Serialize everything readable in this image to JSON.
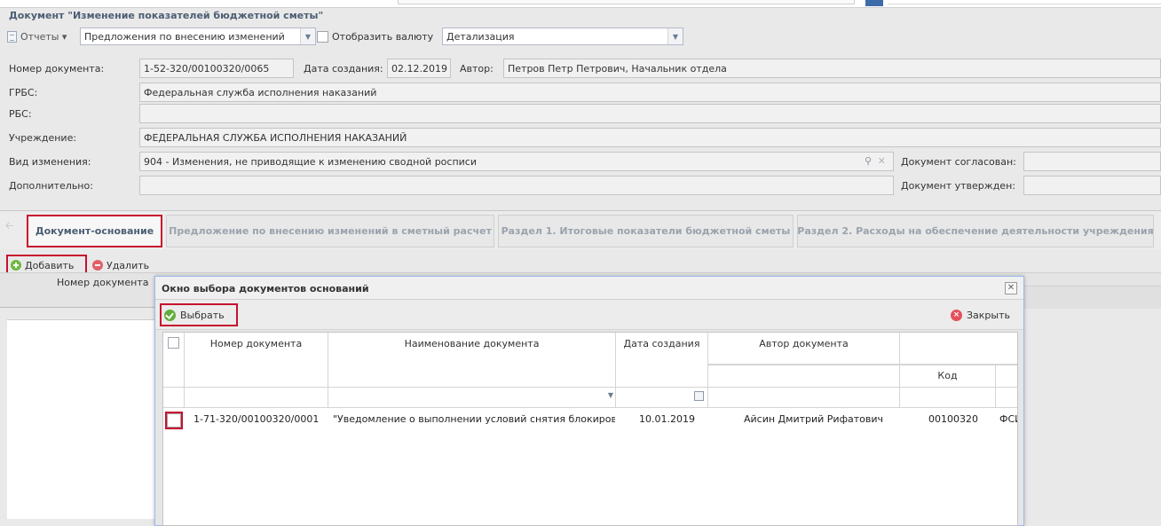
{
  "document": {
    "title": "Документ \"Изменение показателей бюджетной сметы\"",
    "toolbar": {
      "reports_label": "Отчеты ▾",
      "proposal_select_value": "Предложения по внесению изменений",
      "show_currency_label": "Отобразить валюту",
      "detail_select_value": "Детализация"
    },
    "fields": {
      "doc_number_label": "Номер документа:",
      "doc_number_value": "1-52-320/00100320/0065",
      "created_label": "Дата создания:",
      "created_value": "02.12.2019",
      "author_label": "Автор:",
      "author_value": "Петров Петр Петрович,  Начальник отдела",
      "grbs_label": "ГРБС:",
      "grbs_value": "Федеральная служба исполнения наказаний",
      "rbs_label": "РБС:",
      "rbs_value": "",
      "institution_label": "Учреждение:",
      "institution_value": "ФЕДЕРАЛЬНАЯ СЛУЖБА ИСПОЛНЕНИЯ НАКАЗАНИЙ",
      "change_type_label": "Вид изменения:",
      "change_type_value": "904 - Изменения, не приводящие к изменению сводной росписи",
      "additional_label": "Дополнительно:",
      "additional_value": "",
      "agreed_label": "Документ согласован:",
      "approved_label": "Документ утвержден:"
    },
    "tabs": [
      {
        "label": "Документ-основание"
      },
      {
        "label": "Предложение по внесению изменений в сметный расчет"
      },
      {
        "label": "Раздел 1. Итоговые показатели бюджетной сметы"
      },
      {
        "label": "Раздел 2. Расходы на обеспечение деятельности учреждения"
      }
    ],
    "actions": {
      "add_label": "Добавить",
      "delete_label": "Удалить"
    },
    "under_grid_column": "Номер документа"
  },
  "dialog": {
    "title": "Окно выбора документов оснований",
    "select_label": "Выбрать",
    "close_label": "Закрыть",
    "columns": {
      "number": "Номер документа",
      "name": "Наименование документа",
      "date": "Дата создания",
      "author": "Автор документа",
      "code": "Код"
    },
    "rows": [
      {
        "number": "1-71-320/00100320/0001",
        "name": "\"Уведомление о выполнении условий снятия блокировки\"",
        "date": "10.01.2019",
        "author": "Айсин Дмитрий Рифатович",
        "code": "00100320",
        "extra": "ФСИ"
      }
    ]
  },
  "colors": {
    "highlight": "#c8102e",
    "title_text": "#4b5d73",
    "ok_green": "#5fae3a",
    "close_red": "#e5515b"
  }
}
